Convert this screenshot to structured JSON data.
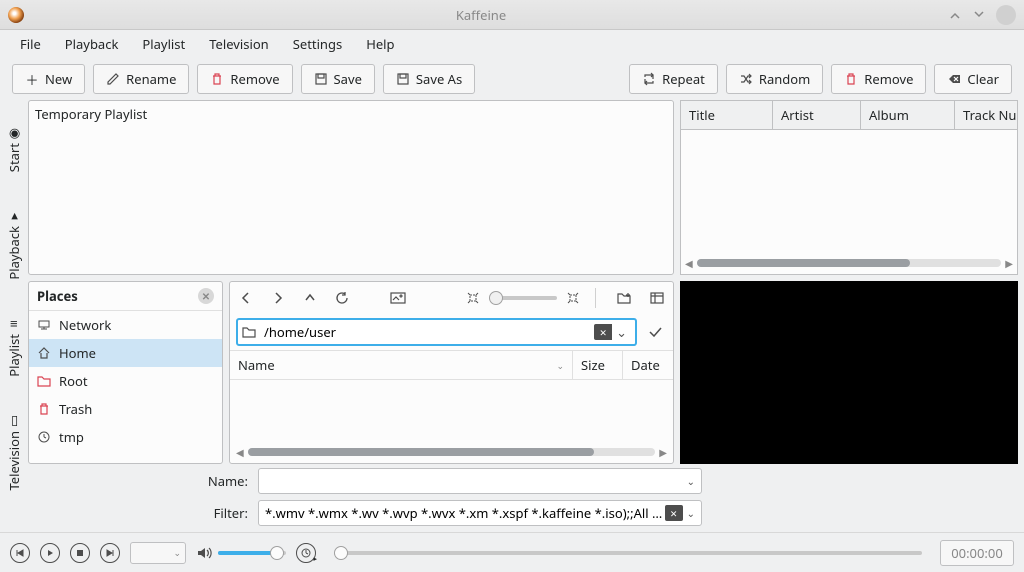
{
  "window": {
    "title": "Kaffeine"
  },
  "menu": {
    "file": "File",
    "playback": "Playback",
    "playlist": "Playlist",
    "television": "Television",
    "settings": "Settings",
    "help": "Help"
  },
  "toolbar": {
    "new": "New",
    "rename": "Rename",
    "remove": "Remove",
    "save": "Save",
    "saveas": "Save As",
    "repeat": "Repeat",
    "random": "Random",
    "remove2": "Remove",
    "clear": "Clear"
  },
  "sidetabs": {
    "start": "Start",
    "playback": "Playback",
    "playlist": "Playlist",
    "television": "Television"
  },
  "playlist": {
    "name": "Temporary Playlist"
  },
  "tracks": {
    "title": "Title",
    "artist": "Artist",
    "album": "Album",
    "tracknum": "Track Nu"
  },
  "places": {
    "header": "Places",
    "items": [
      {
        "label": "Network",
        "icon": "network"
      },
      {
        "label": "Home",
        "icon": "home",
        "selected": true
      },
      {
        "label": "Root",
        "icon": "folder-red"
      },
      {
        "label": "Trash",
        "icon": "trash"
      },
      {
        "label": "tmp",
        "icon": "clock"
      }
    ]
  },
  "browser": {
    "path": "/home/user",
    "cols": {
      "name": "Name",
      "size": "Size",
      "date": "Date"
    }
  },
  "form": {
    "name_label": "Name:",
    "name_value": "",
    "filter_label": "Filter:",
    "filter_value": "*.wmv *.wmx *.wv *.wvp *.wvx *.xm *.xspf *.kaffeine *.iso);;All Files (*)"
  },
  "player": {
    "time": "00:00:00"
  }
}
